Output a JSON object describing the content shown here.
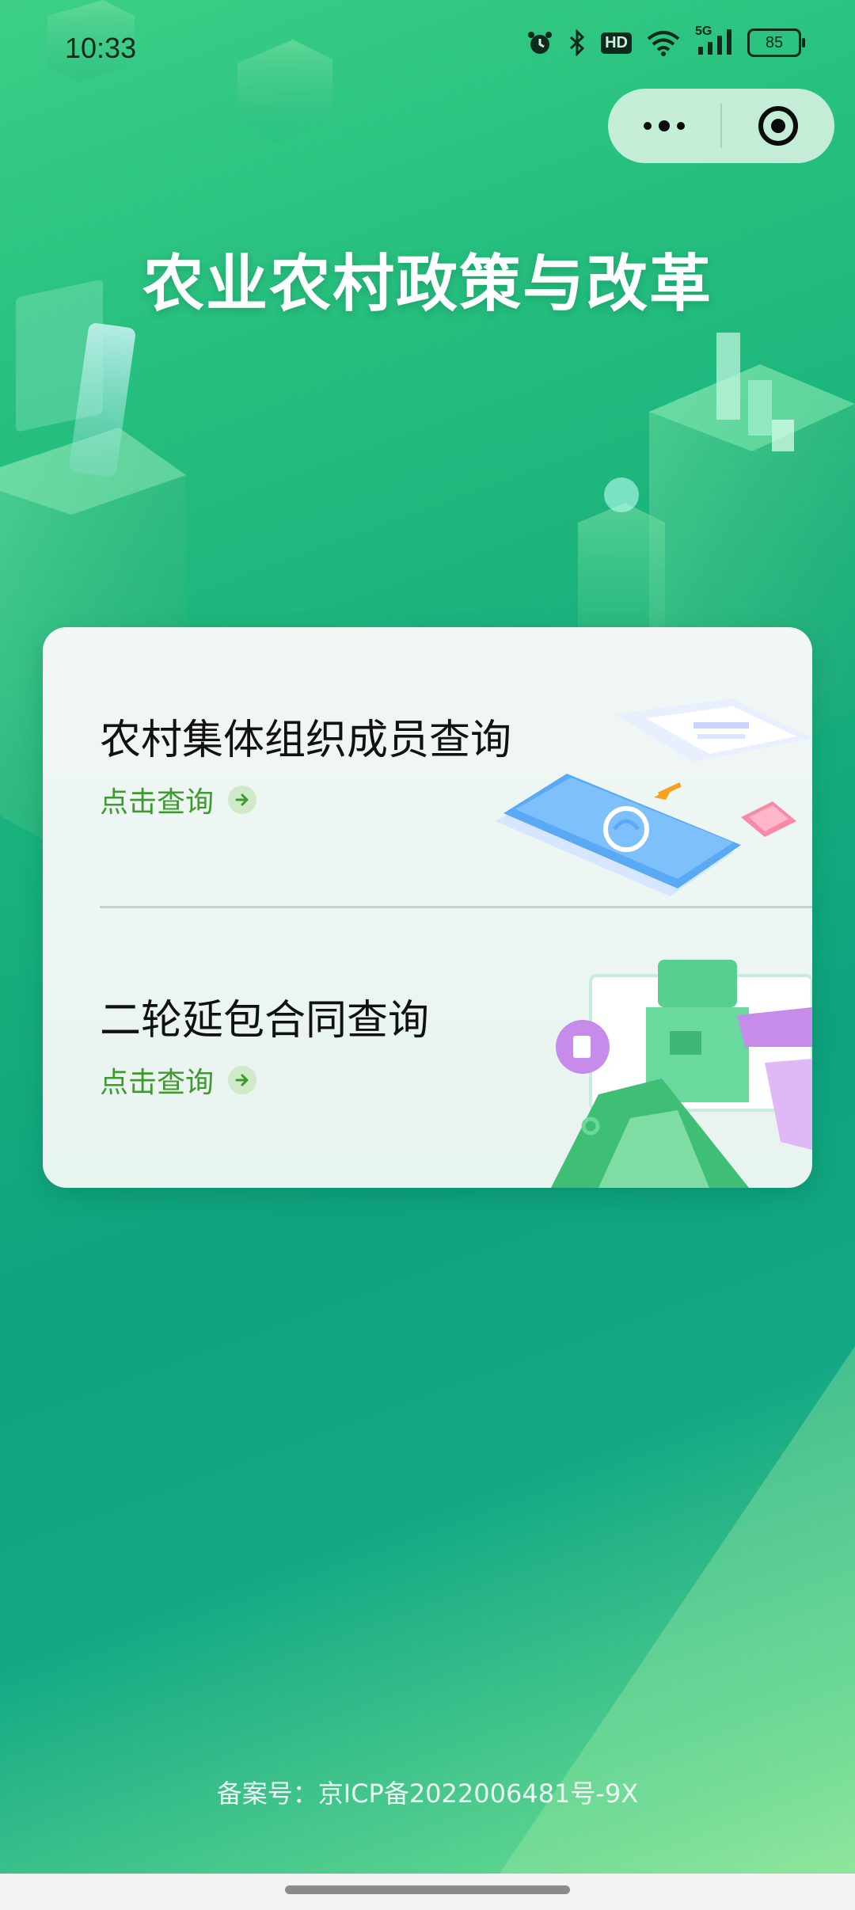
{
  "status_bar": {
    "time": "10:33",
    "hd_label": "HD",
    "network_label": "5G",
    "battery_level": "85",
    "icons": [
      "alarm-icon",
      "bluetooth-icon",
      "hd-icon",
      "wifi-icon",
      "signal-icon",
      "battery-icon"
    ]
  },
  "capsule": {
    "icons": [
      "more-icon",
      "close-miniprogram-icon"
    ]
  },
  "page_title": "农业农村政策与改革",
  "cards": [
    {
      "title": "农村集体组织成员查询",
      "link_label": "点击查询"
    },
    {
      "title": "二轮延包合同查询",
      "link_label": "点击查询"
    }
  ],
  "footer": {
    "icp_text": "备案号：京ICP备2022006481号-9X"
  },
  "colors": {
    "accent_green": "#3e9a2e",
    "title_white": "#ffffff",
    "bg_green": "#18b07c"
  }
}
